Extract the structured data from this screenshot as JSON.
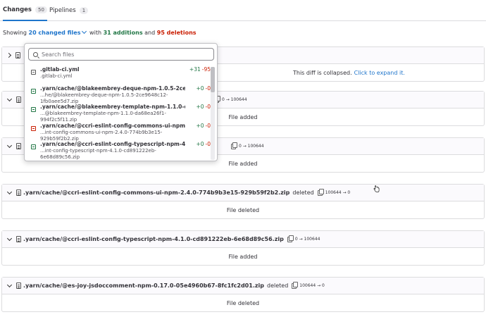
{
  "tabs": [
    {
      "label": "Changes",
      "count": "50"
    },
    {
      "label": "Pipelines",
      "count": "1"
    }
  ],
  "summary": {
    "showing": "Showing",
    "changed_files": "20 changed files",
    "with": "with",
    "additions": "31 additions",
    "and": "and",
    "deletions": "95 deletions"
  },
  "search": {
    "placeholder": "Search files"
  },
  "file_list": [
    {
      "name": ".gitlab-ci.yml",
      "sub": ".gitlab-ci.yml",
      "add": "+31",
      "del": "-95",
      "kind": "modified"
    },
    {
      "name": ".yarn/cache/@blakeembrey-deque-npm-1.0.5-2ce9648c12-",
      "sub": "...he/@blakeembrey-deque-npm-1.0.5-2ce9648c12-1fb0aee5d7.zip",
      "add": "+0",
      "del": "-0",
      "kind": "added"
    },
    {
      "name": ".yarn/cache/@blakeembrey-template-npm-1.1.0-da68e...",
      "sub": "...@blakeembrey-template-npm-1.1.0-da68ea26f1-994f2c5f11.zip",
      "add": "+0",
      "del": "-0",
      "kind": "added"
    },
    {
      "name": ".yarn/cache/@ccri-eslint-config-commons-ui-npm-2.4.0-...",
      "sub": "...int-config-commons-ui-npm-2.4.0-774b9b3e15-929b59f2b2.zip",
      "add": "+0",
      "del": "-0",
      "kind": "deleted"
    },
    {
      "name": ".yarn/cache/@ccri-eslint-config-typescript-npm-4.1.0-c...",
      "sub": "...int-config-typescript-npm-4.1.0-cd891222eb-6e68d89c56.zip",
      "add": "+0",
      "del": "-0",
      "kind": "added"
    }
  ],
  "files": [
    {
      "path": "",
      "status": "",
      "mode": "",
      "body": "This diff is collapsed.",
      "expand": "Click to expand it."
    },
    {
      "path": "",
      "status": "",
      "mode": "0 → 100644",
      "body": "File added"
    },
    {
      "path": "",
      "status": "",
      "mode": "0 → 100644",
      "body": "File added"
    },
    {
      "path": ".yarn/cache/@ccri-eslint-config-commons-ui-npm-2.4.0-774b9b3e15-929b59f2b2.zip",
      "status": "deleted",
      "mode": "100644 → 0",
      "body": "File deleted"
    },
    {
      "path": ".yarn/cache/@ccri-eslint-config-typescript-npm-4.1.0-cd891222eb-6e68d89c56.zip",
      "status": "",
      "mode": "0 → 100644",
      "body": "File added"
    },
    {
      "path": ".yarn/cache/@es-joy-jsdoccomment-npm-0.17.0-05e4960b67-8fc1fc2d01.zip",
      "status": "deleted",
      "mode": "100644 → 0",
      "body": "File deleted"
    }
  ],
  "colors": {
    "accent": "#1f75cb",
    "addition": "#217645",
    "deletion": "#c91c00"
  }
}
